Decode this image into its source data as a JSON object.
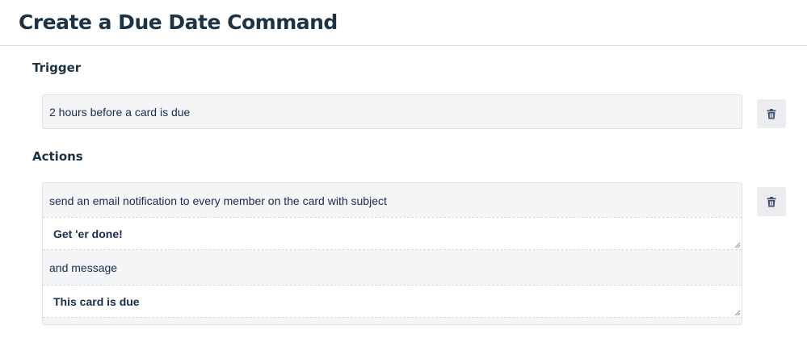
{
  "page": {
    "title": "Create a Due Date Command"
  },
  "trigger": {
    "label": "Trigger",
    "value": "2 hours before a card is due",
    "delete_icon": "trash-icon"
  },
  "actions": {
    "label": "Actions",
    "delete_icon": "trash-icon",
    "text_before_subject": "send an email notification to every member on the card with subject",
    "subject_value": "Get 'er done!",
    "text_before_message": "and message",
    "message_value": "This card is due"
  }
}
